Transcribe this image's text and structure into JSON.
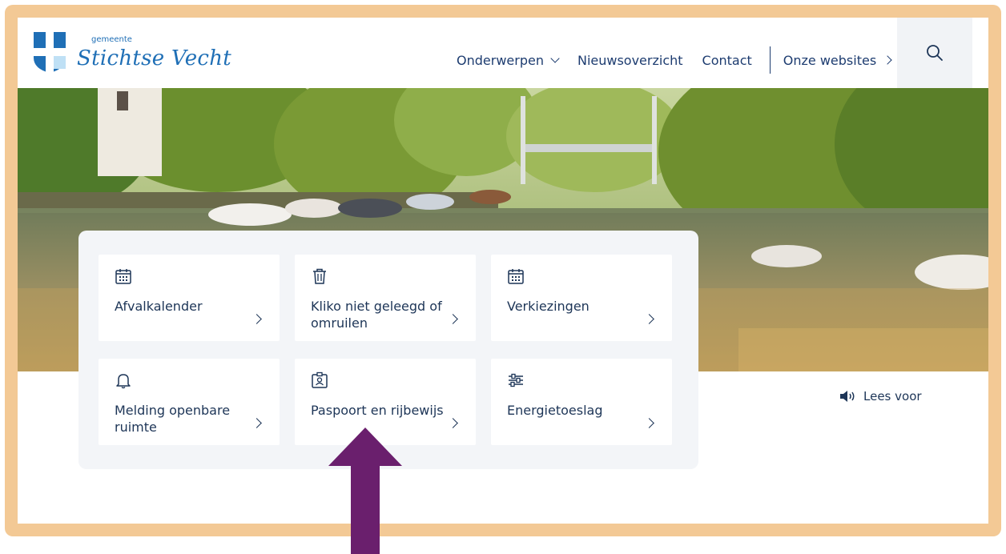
{
  "brand": {
    "small": "gemeente",
    "name": "Stichtse Vecht",
    "color": "#1f6fb6"
  },
  "nav": {
    "items": [
      {
        "label": "Onderwerpen",
        "icon": "chevron-down-icon"
      },
      {
        "label": "Nieuwsoverzicht"
      },
      {
        "label": "Contact"
      },
      {
        "label": "Onze websites",
        "icon": "chevron-right-icon"
      }
    ],
    "search_icon": "search-icon"
  },
  "tiles": [
    {
      "label": "Afvalkalender",
      "icon": "calendar-icon"
    },
    {
      "label": "Kliko niet geleegd of omruilen",
      "icon": "trash-icon"
    },
    {
      "label": "Verkiezingen",
      "icon": "calendar-icon"
    },
    {
      "label": "Melding openbare ruimte",
      "icon": "bell-icon"
    },
    {
      "label": "Paspoort en rijbewijs",
      "icon": "id-card-icon"
    },
    {
      "label": "Energietoeslag",
      "icon": "sliders-icon"
    }
  ],
  "read_aloud": {
    "label": "Lees voor",
    "icon": "speaker-icon"
  },
  "colors": {
    "frame": "#f3c995",
    "text": "#1d3557",
    "arrow": "#6a1f6d",
    "panel": "#f3f5f8"
  }
}
